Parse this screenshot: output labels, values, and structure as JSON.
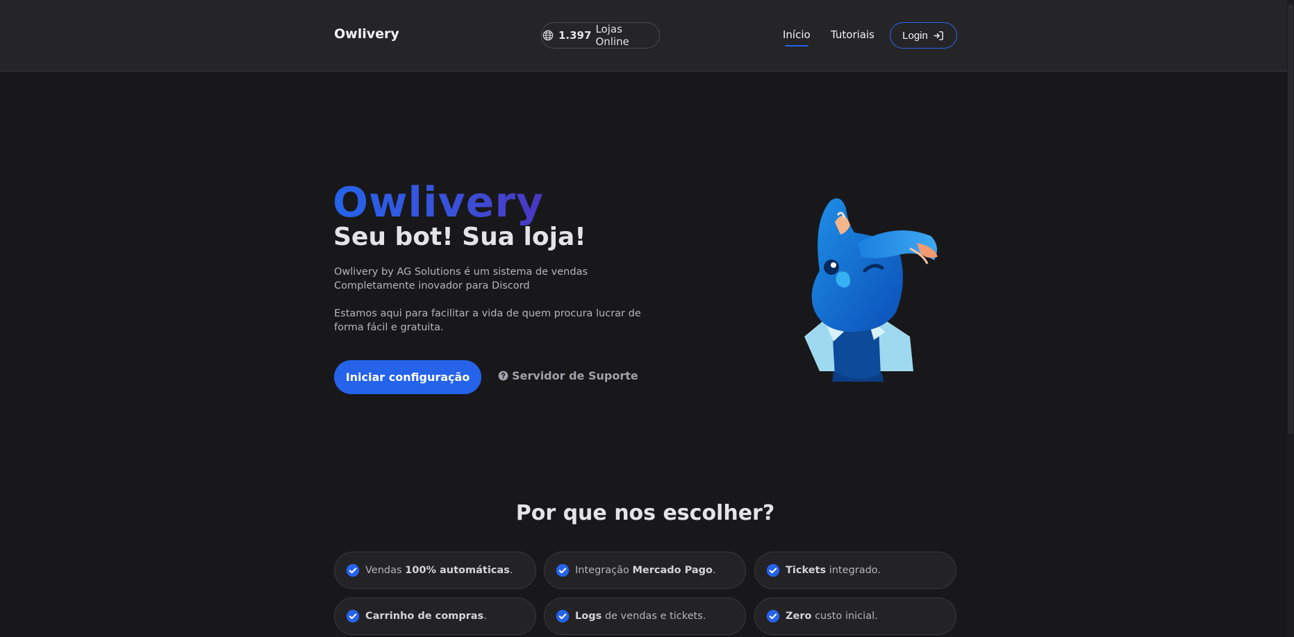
{
  "nav": {
    "brand": "Owlivery",
    "stores_count": "1.397",
    "stores_label": "Lojas Online",
    "links": [
      "Início",
      "Tutoriais"
    ],
    "login": "Login"
  },
  "hero": {
    "title": "Owlivery",
    "subtitle": "Seu bot! Sua loja!",
    "desc1_line1": "Owlivery by AG Solutions é um sistema de vendas",
    "desc1_line2": "Completamente inovador para Discord",
    "desc2_line1": "Estamos aqui para facilitar a vida de quem procura lucrar de",
    "desc2_line2": "forma fácil e gratuita.",
    "cta_primary": "Iniciar configuração",
    "cta_support": "Servidor de Suporte"
  },
  "why": {
    "title": "Por que nos escolher?",
    "features": [
      {
        "pre": "Vendas ",
        "bold": "100% automáticas",
        "post": "."
      },
      {
        "pre": "Integração ",
        "bold": "Mercado Pago",
        "post": "."
      },
      {
        "pre": "",
        "bold": "Tickets",
        "post": " integrado."
      },
      {
        "pre": "",
        "bold": "Carrinho de compras",
        "post": "."
      },
      {
        "pre": "",
        "bold": "Logs",
        "post": " de vendas e tickets."
      },
      {
        "pre": "",
        "bold": "Zero",
        "post": " custo inicial."
      }
    ]
  },
  "icons": {
    "globe": "globe-icon",
    "login": "login-arrow-icon",
    "help": "question-circle-icon",
    "check": "check-circle-icon"
  },
  "colors": {
    "accent": "#2563eb",
    "background": "#18181b",
    "navbar": "#252528"
  }
}
